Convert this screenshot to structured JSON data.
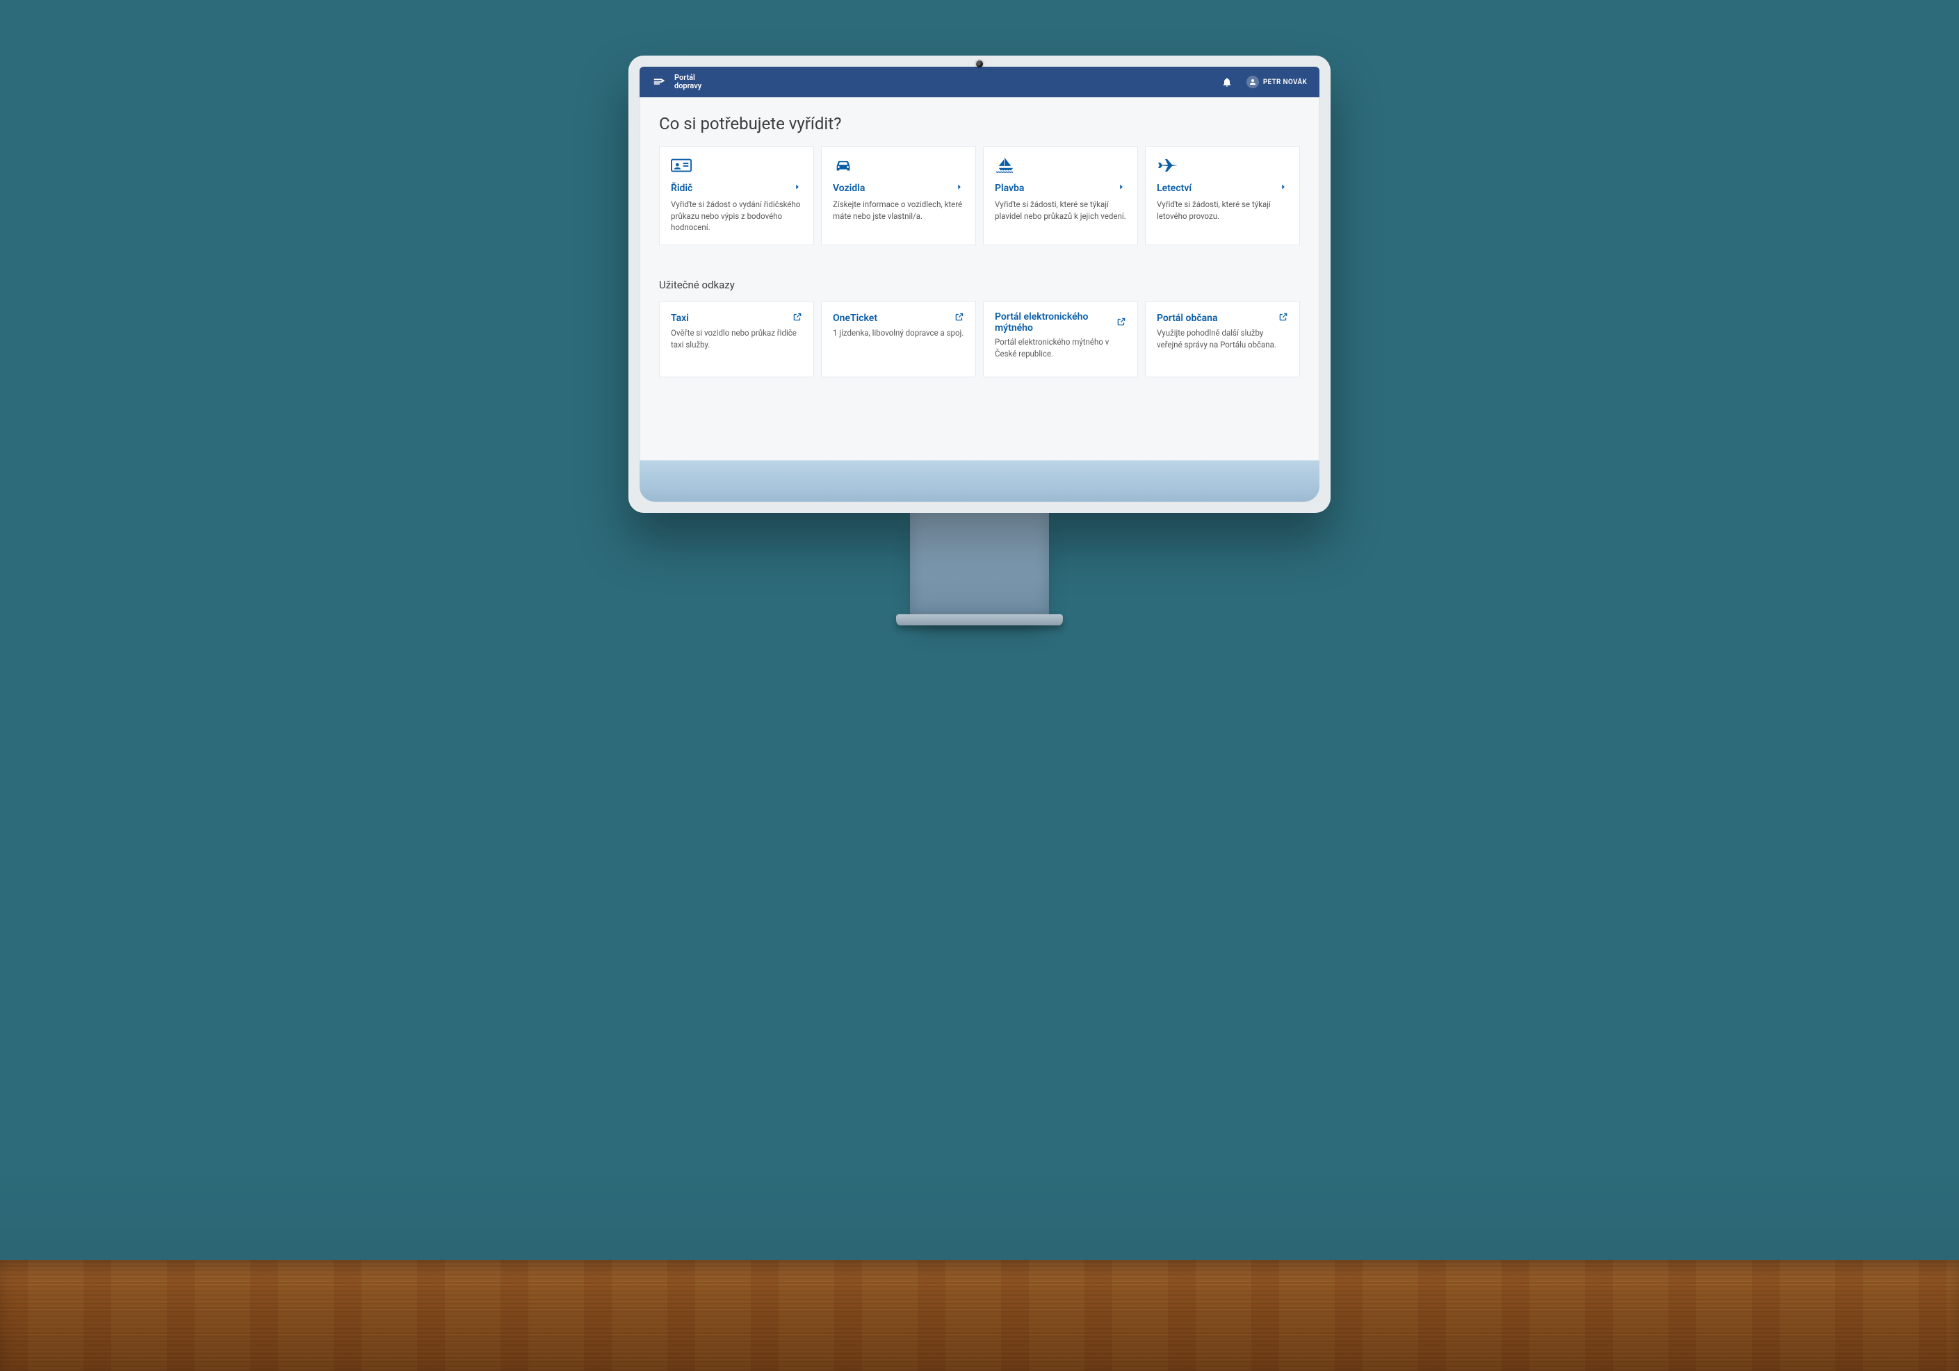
{
  "header": {
    "logo_line1": "Portál",
    "logo_line2": "dopravy",
    "user_name": "PETR NOVÁK"
  },
  "page_title": "Co si potřebujete vyřídit?",
  "cards": [
    {
      "title": "Řidič",
      "desc": "Vyřiďte si žádost o vydání řidičského průkazu nebo výpis z bodového hodnocení."
    },
    {
      "title": "Vozidla",
      "desc": "Získejte informace o vozidlech, které máte nebo jste vlastnil/a."
    },
    {
      "title": "Plavba",
      "desc": "Vyřiďte si žádosti, které se týkají plavidel nebo průkazů k jejich vedení."
    },
    {
      "title": "Letectví",
      "desc": "Vyřiďte si žádosti, které se týkají letového provozu."
    }
  ],
  "useful_links_title": "Užitečné odkazy",
  "links": [
    {
      "title": "Taxi",
      "desc": "Ověřte si vozidlo nebo průkaz řidiče taxi služby."
    },
    {
      "title": "OneTicket",
      "desc": "1 jízdenka, libovolný dopravce a spoj."
    },
    {
      "title": "Portál elektronického mýtného",
      "desc": "Portál elektronického mýtného v České republice."
    },
    {
      "title": "Portál občana",
      "desc": "Využijte pohodlně další služby veřejné správy na Portálu občana."
    }
  ],
  "colors": {
    "brand_header": "#2c4e86",
    "accent": "#0a5ea8"
  }
}
